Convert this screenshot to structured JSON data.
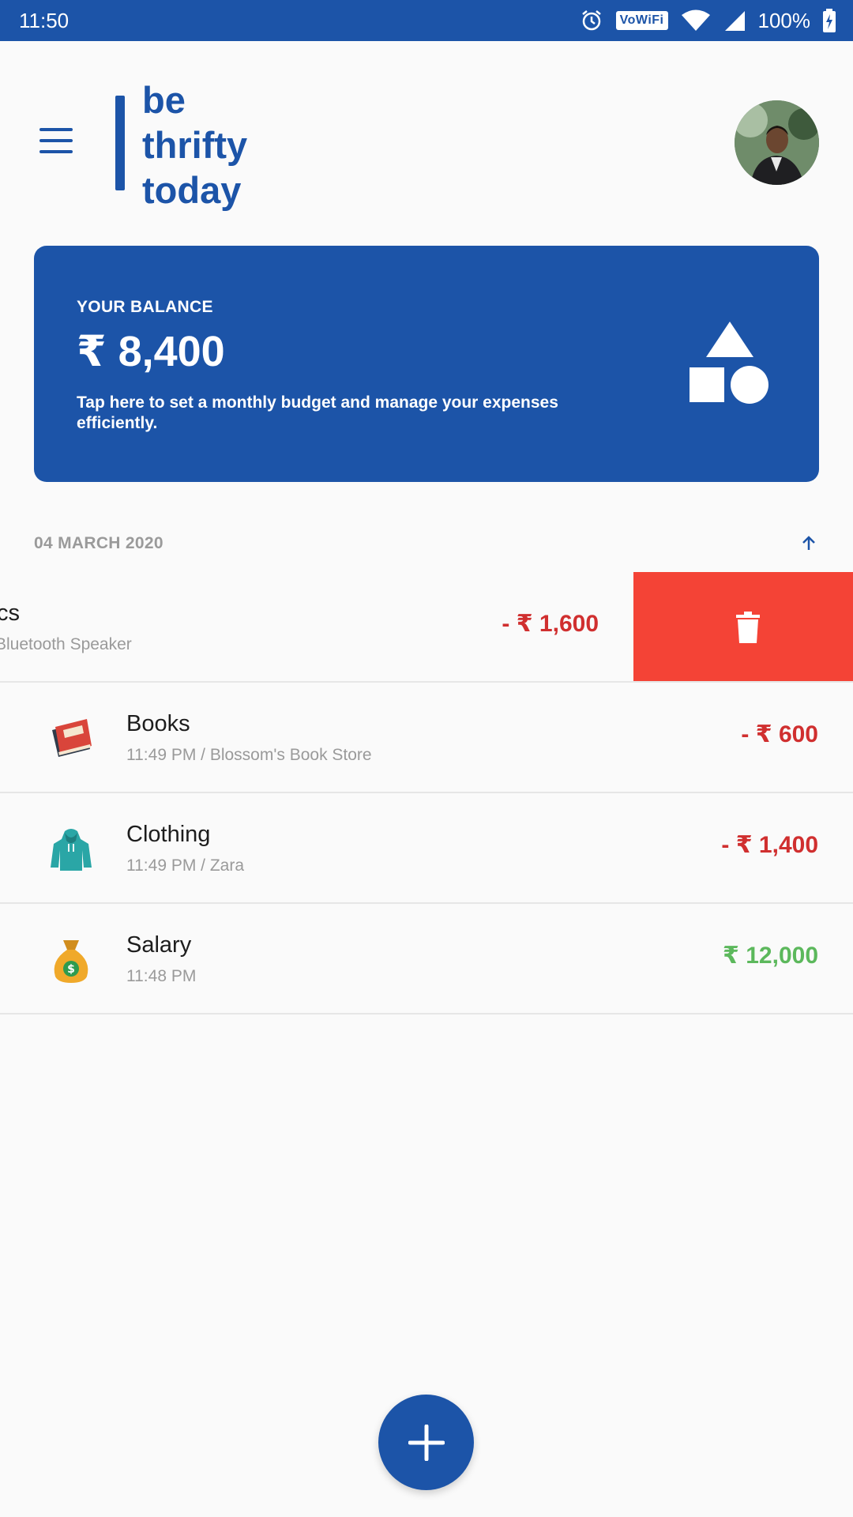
{
  "status_bar": {
    "time": "11:50",
    "vowifi_label": "VoWiFi",
    "battery": "100%"
  },
  "header": {
    "brand_lines": [
      "be",
      "thrifty",
      "today"
    ]
  },
  "balance": {
    "label": "YOUR BALANCE",
    "amount": "₹ 8,400",
    "hint": "Tap here to set a monthly budget and manage your expenses efficiently."
  },
  "date_section": {
    "date": "04 MARCH 2020"
  },
  "transactions": [
    {
      "title": "cs",
      "subtitle": "Bluetooth Speaker",
      "amount": "- ₹ 1,600",
      "icon": "electronics-icon"
    },
    {
      "title": "Books",
      "subtitle": "11:49 PM  /  Blossom's Book Store",
      "amount": "- ₹ 600",
      "icon": "book-icon"
    },
    {
      "title": "Clothing",
      "subtitle": "11:49 PM  /  Zara",
      "amount": "- ₹ 1,400",
      "icon": "hoodie-icon"
    },
    {
      "title": "Salary",
      "subtitle": "11:48 PM",
      "amount": "₹ 12,000",
      "icon": "money-bag-icon"
    }
  ],
  "colors": {
    "primary": "#1c54a8",
    "expense": "#d02f2f",
    "income": "#5cb85c",
    "delete": "#f44336"
  }
}
